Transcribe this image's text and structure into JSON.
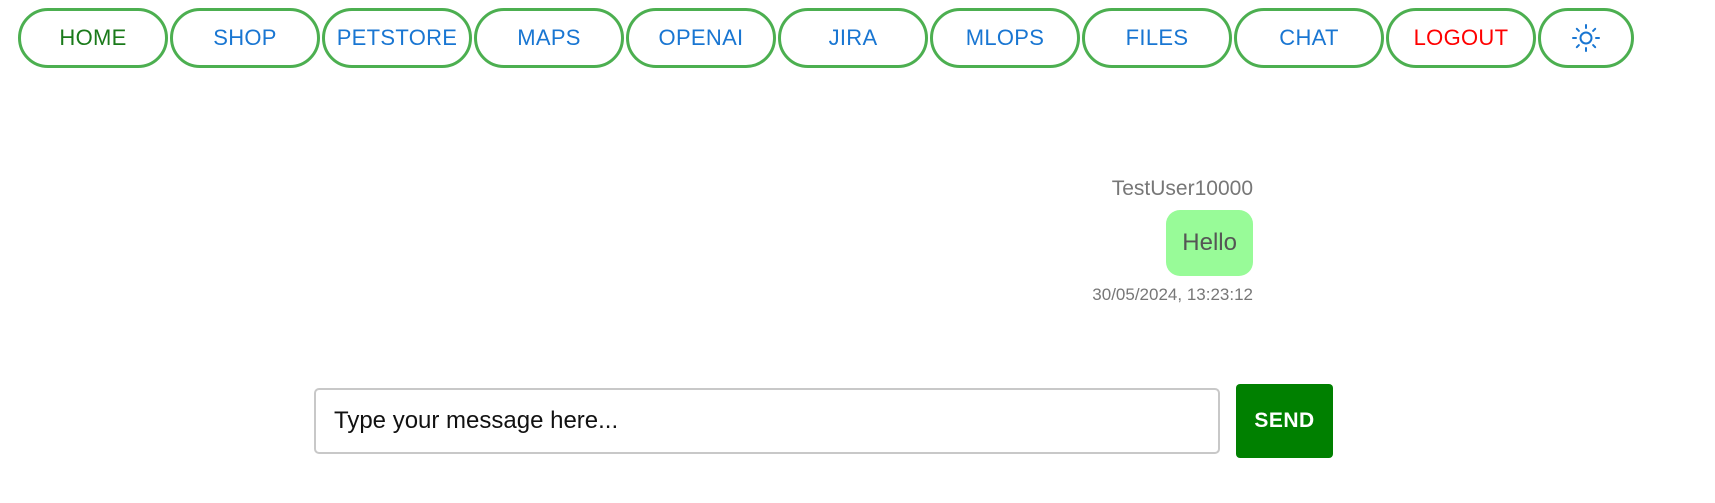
{
  "nav": {
    "items": [
      {
        "label": "HOME"
      },
      {
        "label": "SHOP"
      },
      {
        "label": "PETSTORE"
      },
      {
        "label": "MAPS"
      },
      {
        "label": "OPENAI"
      },
      {
        "label": "JIRA"
      },
      {
        "label": "MLOPS"
      },
      {
        "label": "FILES"
      },
      {
        "label": "CHAT"
      },
      {
        "label": "LOGOUT"
      }
    ],
    "theme_icon": "sun-icon"
  },
  "messages": [
    {
      "user": "TestUser10000",
      "text": "Hello",
      "timestamp": "30/05/2024, 13:23:12"
    }
  ],
  "composer": {
    "placeholder": "Type your message here...",
    "value": "",
    "send_label": "SEND"
  },
  "colors": {
    "nav_border": "#4caf50",
    "nav_text": "#1976d2",
    "home_text": "#1a7a1a",
    "logout_text": "#ff0000",
    "bubble": "#98fb98",
    "send_button": "#008000"
  }
}
